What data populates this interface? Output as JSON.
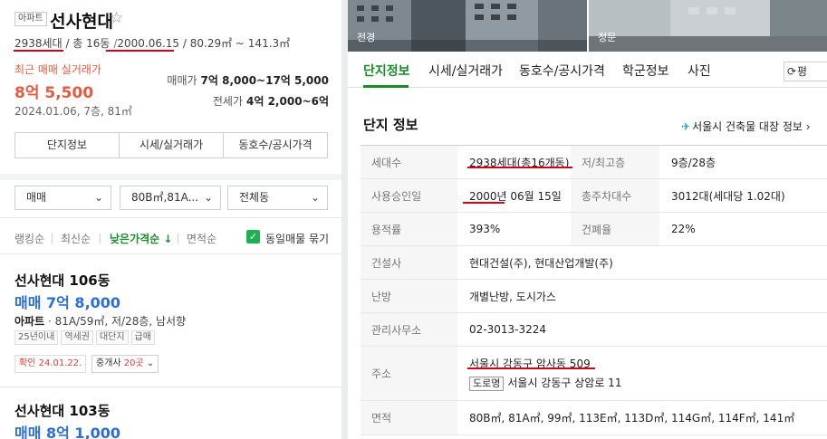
{
  "left": {
    "type_badge": "아파트",
    "complex_name": "선사현대",
    "star": "☆",
    "households": "2938세대",
    "buildings": "/ 총 16동",
    "sep1": "/",
    "approval_date": "2000.06.15",
    "area_range": "/ 80.29㎡ ~ 141.3㎡",
    "recent_label": "최근 매매 실거래가",
    "recent_price": "8억 5,500",
    "recent_date": "2024.01.06, 7층, 81㎡",
    "sale_key": "매매가",
    "sale_val": "7억 8,000~17억 5,000",
    "jeonse_key": "전세가",
    "jeonse_val": "4억 2,000~6억",
    "tab_buttons": [
      "단지정보",
      "시세/실거래가",
      "동호수/공시가격"
    ],
    "filters": {
      "trade": "매매",
      "area": "80B㎡,81A...",
      "dong": "전체동"
    },
    "sorts": [
      "랭킹순",
      "최신순",
      "낮은가격순 ↓",
      "면적순"
    ],
    "same_listing": "동일매물 묶기",
    "items": [
      {
        "name": "선사현대 106동",
        "price": "매매 7억 8,000",
        "spec_bold": "아파트",
        "spec": " · 81A/59㎡, 저/28층, 남서향",
        "tags": [
          "25년이내",
          "역세권",
          "대단지",
          "급매"
        ],
        "confirm": "확인 24.01.22.",
        "agent_prefix": "중개사 ",
        "agent_count": "20곳",
        "agent_chev": "⌄"
      },
      {
        "name": "선사현대 103동",
        "price": "매매 8억 1,000"
      }
    ]
  },
  "right": {
    "photos": [
      "전경",
      "정문"
    ],
    "tabs": [
      "단지정보",
      "시세/실거래가",
      "동호수/공시가격",
      "학군정보",
      "사진"
    ],
    "refresh_label": "평",
    "refresh_icon": "⟳",
    "info_title": "단지 정보",
    "building_link": "서울시 건축물 대장 정보",
    "building_link_chev": "›",
    "rows": {
      "households_h": "세대수",
      "households_v": "2938세대(총16개동)",
      "floors_h": "저/최고층",
      "floors_v": "9층/28층",
      "approval_h": "사용승인일",
      "approval_v": "2000년 06월 15일",
      "parking_h": "총주차대수",
      "parking_v": "3012대(세대당 1.02대)",
      "far_h": "용적률",
      "far_v": "393%",
      "bcr_h": "건폐율",
      "bcr_v": "22%",
      "builder_h": "건설사",
      "builder_v": "현대건설(주), 현대산업개발(주)",
      "heating_h": "난방",
      "heating_v": "개별난방, 도시가스",
      "office_h": "관리사무소",
      "office_v": "02-3013-3224",
      "address_h": "주소",
      "address_v": "서울시 강동구 암사동 509",
      "road_badge": "도로명",
      "road_v": "서울시 강동구 상암로 11",
      "area_h": "면적",
      "area_v": "80B㎡, 81A㎡, 99㎡, 113E㎡, 113D㎡, 114G㎡, 114F㎡, 141㎡"
    }
  },
  "colors": {
    "accent_green": "#1a8a2a",
    "price_red": "#e55a3c",
    "price_blue": "#2a6fdb",
    "underline_red": "#d0021b"
  }
}
